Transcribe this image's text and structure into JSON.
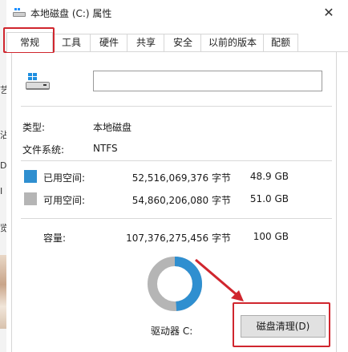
{
  "window": {
    "title": "本地磁盘 (C:) 属性",
    "close_symbol": "✕"
  },
  "tabs": [
    {
      "label": "常规",
      "active": true
    },
    {
      "label": "工具"
    },
    {
      "label": "硬件"
    },
    {
      "label": "共享"
    },
    {
      "label": "安全"
    },
    {
      "label": "以前的版本"
    },
    {
      "label": "配额"
    }
  ],
  "general": {
    "name_input_value": "",
    "type_label": "类型:",
    "type_value": "本地磁盘",
    "fs_label": "文件系统:",
    "fs_value": "NTFS",
    "used": {
      "label": "已用空间:",
      "bytes": "52,516,069,376 字节",
      "size": "48.9 GB",
      "color": "#2f8fd0"
    },
    "free": {
      "label": "可用空间:",
      "bytes": "54,860,206,080 字节",
      "size": "51.0 GB",
      "color": "#b5b5b5"
    },
    "capacity": {
      "label": "容量:",
      "bytes": "107,376,275,456 字节",
      "size": "100 GB"
    },
    "used_fraction": 0.489,
    "drive_label": "驱动器 C:",
    "cleanup_button": "磁盘清理(D)"
  },
  "background": {
    "left_glyphs": [
      "艺",
      "沾",
      "D",
      "Ⅰ",
      "览"
    ]
  },
  "annotation_color": "#d0262e"
}
